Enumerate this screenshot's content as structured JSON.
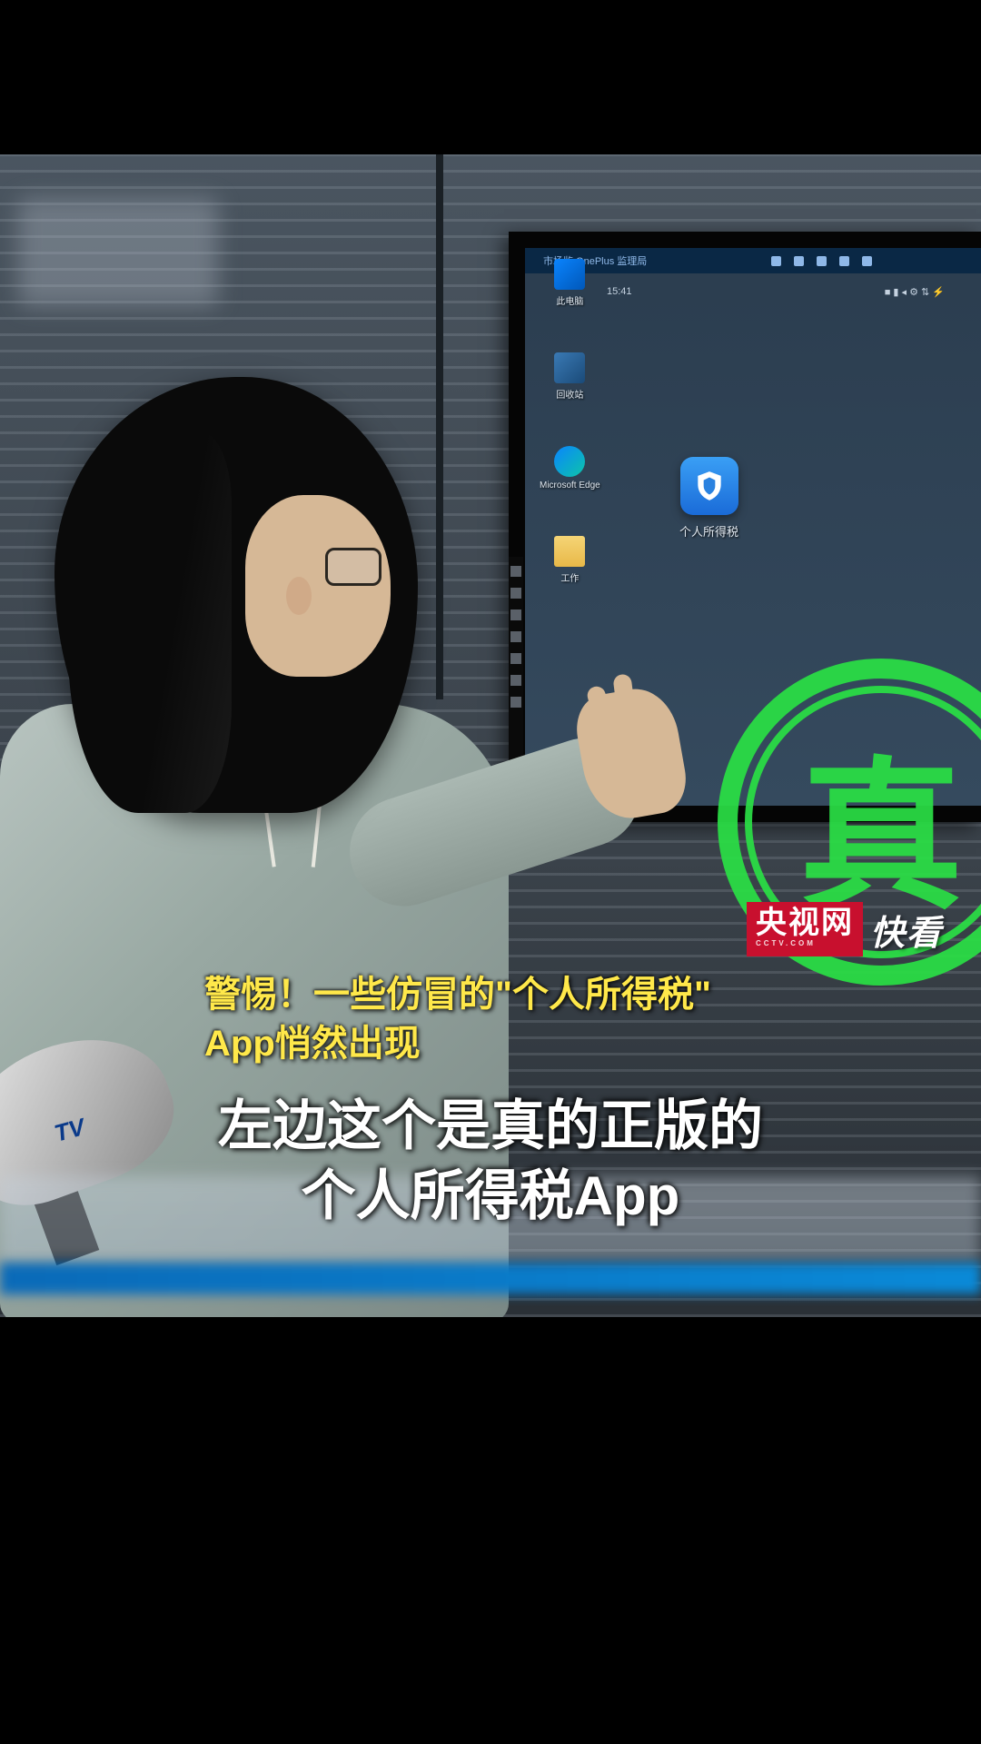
{
  "channel": {
    "logo_main": "央视网",
    "logo_sub": "CCTV.COM",
    "logo_side": "快看",
    "mic_logo": "TV"
  },
  "caption": {
    "title_line1": "警惕！一些仿冒的\"个人所得税\"",
    "title_line2": "App悄然出现",
    "subtitle_line1": "左边这个是真的正版的",
    "subtitle_line2": "个人所得税App"
  },
  "monitor": {
    "topbar_text": "市场监 OnePlus 监理局",
    "time": "15:41",
    "status": "■ ▮ ◂ ⚙ ⇅ ⚡",
    "app_label": "个人所得税",
    "desktop": {
      "icon1": "此电脑",
      "icon2": "回收站",
      "icon3": "Microsoft Edge",
      "icon4": "工作"
    }
  },
  "stamp": "真"
}
